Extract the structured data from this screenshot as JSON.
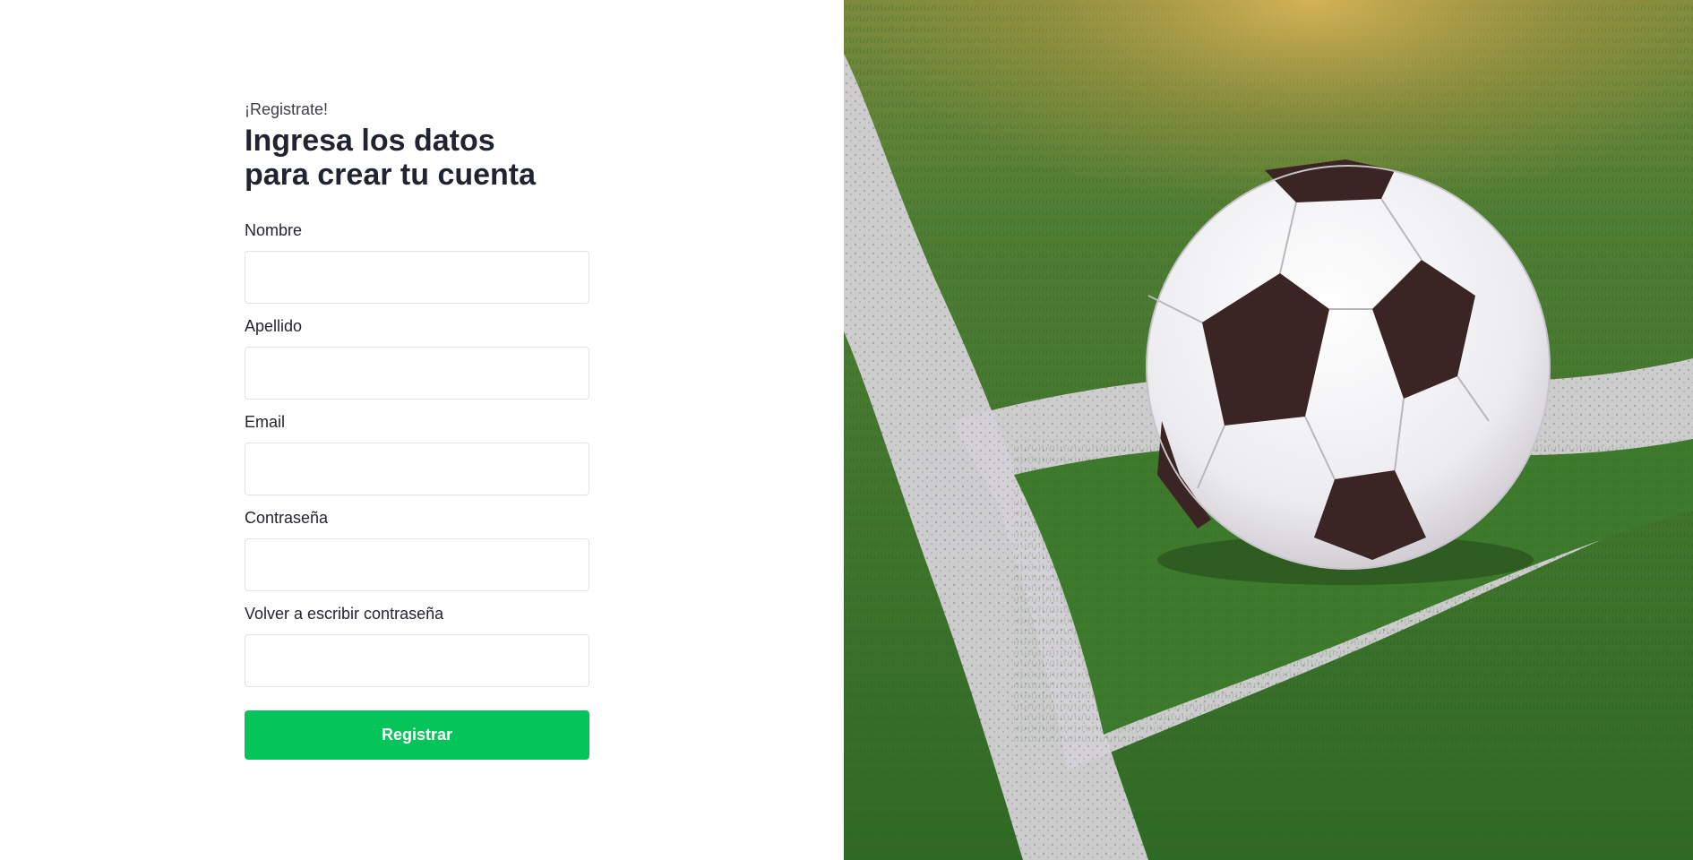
{
  "form": {
    "eyebrow": "¡Registrate!",
    "title": "Ingresa los datos para crear tu cuenta",
    "fields": [
      {
        "label": "Nombre",
        "value": "",
        "placeholder": ""
      },
      {
        "label": "Apellido",
        "value": "",
        "placeholder": ""
      },
      {
        "label": "Email",
        "value": "",
        "placeholder": ""
      },
      {
        "label": "Contraseña",
        "value": "",
        "placeholder": ""
      },
      {
        "label": "Volver a escribir contraseña",
        "value": "",
        "placeholder": ""
      }
    ],
    "submit_label": "Registrar"
  },
  "hero_image": {
    "subject": "soccer-ball-on-field-corner",
    "colors": {
      "grass": "#3f7a2e",
      "line": "#d8d6d8",
      "ball_white": "#f4f4f6",
      "ball_patch": "#3a2424",
      "glow": "#c9a94f"
    }
  },
  "colors": {
    "accent": "#04c45a",
    "text": "#1f2430",
    "border": "#dfe2e6"
  }
}
